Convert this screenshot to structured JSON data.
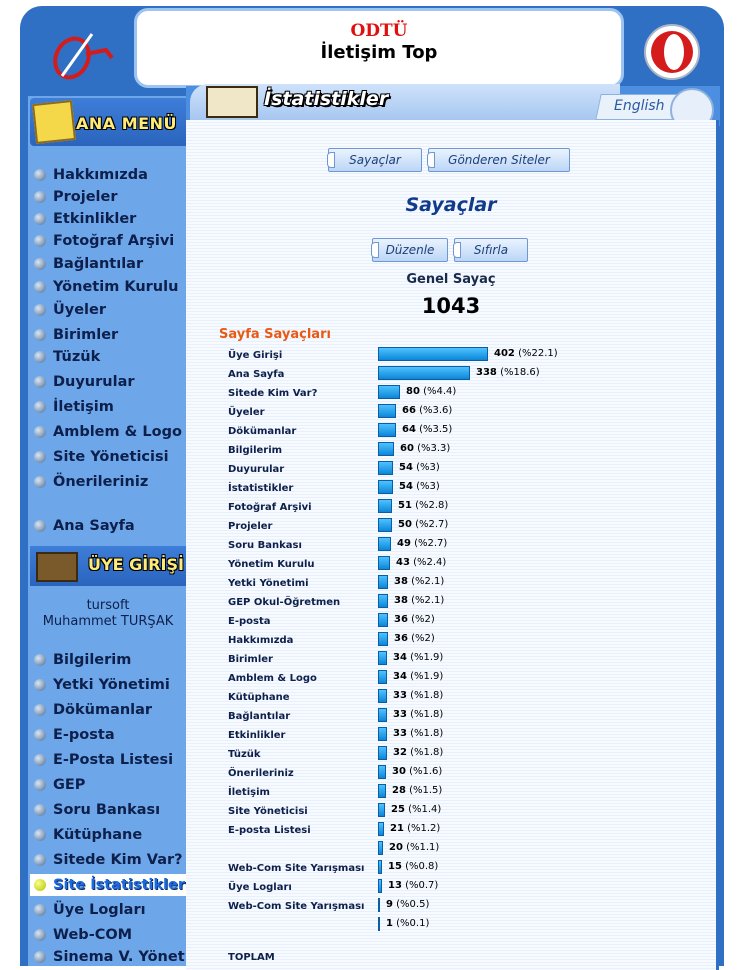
{
  "header": {
    "org": "ODTÜ",
    "site_title": "İletişim Top",
    "accent_color": "#2f6fc4"
  },
  "sidebar": {
    "menu_title": "ANA MENÜ",
    "items": [
      {
        "label": "Hakkımızda"
      },
      {
        "label": "Projeler"
      },
      {
        "label": "Etkinlikler"
      },
      {
        "label": "Fotoğraf Arşivi"
      },
      {
        "label": "Bağlantılar"
      },
      {
        "label": "Yönetim Kurulu"
      },
      {
        "label": "Üyeler"
      },
      {
        "label": "Birimler"
      },
      {
        "label": "Tüzük"
      },
      {
        "label": "Duyurular"
      },
      {
        "label": "İletişim"
      },
      {
        "label": "Amblem & Logo"
      },
      {
        "label": "Site Yöneticisi"
      },
      {
        "label": "Önerileriniz"
      },
      {
        "label": "Ana Sayfa"
      }
    ],
    "member_title": "ÜYE GİRİŞİ",
    "username": "tursoft",
    "fullname": "Muhammet TURŞAK",
    "member_items": [
      {
        "label": "Bilgilerim"
      },
      {
        "label": "Yetki Yönetimi"
      },
      {
        "label": "Dökümanlar"
      },
      {
        "label": "E-posta"
      },
      {
        "label": "E-Posta Listesi"
      },
      {
        "label": "GEP"
      },
      {
        "label": "Soru Bankası"
      },
      {
        "label": "Kütüphane"
      },
      {
        "label": "Sitede Kim Var?"
      },
      {
        "label": "Site İstatistikleri",
        "active": true
      },
      {
        "label": "Üye Logları"
      },
      {
        "label": "Web-COM"
      },
      {
        "label": "Sinema V. Yönet"
      }
    ]
  },
  "content": {
    "tab_title": "İstatistikler",
    "language_link": "English",
    "tabs": [
      "Sayaçlar",
      "Gönderen Siteler"
    ],
    "section_title": "Sayaçlar",
    "actions": [
      "Düzenle",
      "Sıfırla"
    ],
    "genel_label": "Genel Sayaç",
    "genel_value": "1043",
    "sayfa_title": "Sayfa Sayaçları",
    "toplam_label": "TOPLAM",
    "counters": [
      {
        "name": "Üye Girişi",
        "count": 402,
        "pct": "(%22.1)"
      },
      {
        "name": "Ana Sayfa",
        "count": 338,
        "pct": "(%18.6)"
      },
      {
        "name": "Sitede Kim Var?",
        "count": 80,
        "pct": "(%4.4)"
      },
      {
        "name": "Üyeler",
        "count": 66,
        "pct": "(%3.6)"
      },
      {
        "name": "Dökümanlar",
        "count": 64,
        "pct": "(%3.5)"
      },
      {
        "name": "Bilgilerim",
        "count": 60,
        "pct": "(%3.3)"
      },
      {
        "name": "Duyurular",
        "count": 54,
        "pct": "(%3)"
      },
      {
        "name": "İstatistikler",
        "count": 54,
        "pct": "(%3)"
      },
      {
        "name": "Fotoğraf Arşivi",
        "count": 51,
        "pct": "(%2.8)"
      },
      {
        "name": "Projeler",
        "count": 50,
        "pct": "(%2.7)"
      },
      {
        "name": "Soru Bankası",
        "count": 49,
        "pct": "(%2.7)"
      },
      {
        "name": "Yönetim Kurulu",
        "count": 43,
        "pct": "(%2.4)"
      },
      {
        "name": "Yetki Yönetimi",
        "count": 38,
        "pct": "(%2.1)"
      },
      {
        "name": "GEP Okul-Öğretmen",
        "count": 38,
        "pct": "(%2.1)"
      },
      {
        "name": "E-posta",
        "count": 36,
        "pct": "(%2)"
      },
      {
        "name": "Hakkımızda",
        "count": 36,
        "pct": "(%2)"
      },
      {
        "name": "Birimler",
        "count": 34,
        "pct": "(%1.9)"
      },
      {
        "name": "Amblem & Logo",
        "count": 34,
        "pct": "(%1.9)"
      },
      {
        "name": "Kütüphane",
        "count": 33,
        "pct": "(%1.8)"
      },
      {
        "name": "Bağlantılar",
        "count": 33,
        "pct": "(%1.8)"
      },
      {
        "name": "Etkinlikler",
        "count": 33,
        "pct": "(%1.8)"
      },
      {
        "name": "Tüzük",
        "count": 32,
        "pct": "(%1.8)"
      },
      {
        "name": "Önerileriniz",
        "count": 30,
        "pct": "(%1.6)"
      },
      {
        "name": "İletişim",
        "count": 28,
        "pct": "(%1.5)"
      },
      {
        "name": "Site Yöneticisi",
        "count": 25,
        "pct": "(%1.4)"
      },
      {
        "name": "E-posta Listesi",
        "count": 21,
        "pct": "(%1.2)"
      },
      {
        "name": "",
        "count": 20,
        "pct": "(%1.1)"
      },
      {
        "name": "Web-Com Site Yarışması",
        "count": 15,
        "pct": "(%0.8)"
      },
      {
        "name": "Üye Logları",
        "count": 13,
        "pct": "(%0.7)"
      },
      {
        "name": "Web-Com Site Yarışması",
        "count": 9,
        "pct": "(%0.5)"
      },
      {
        "name": "",
        "count": 1,
        "pct": "(%0.1)"
      }
    ]
  }
}
